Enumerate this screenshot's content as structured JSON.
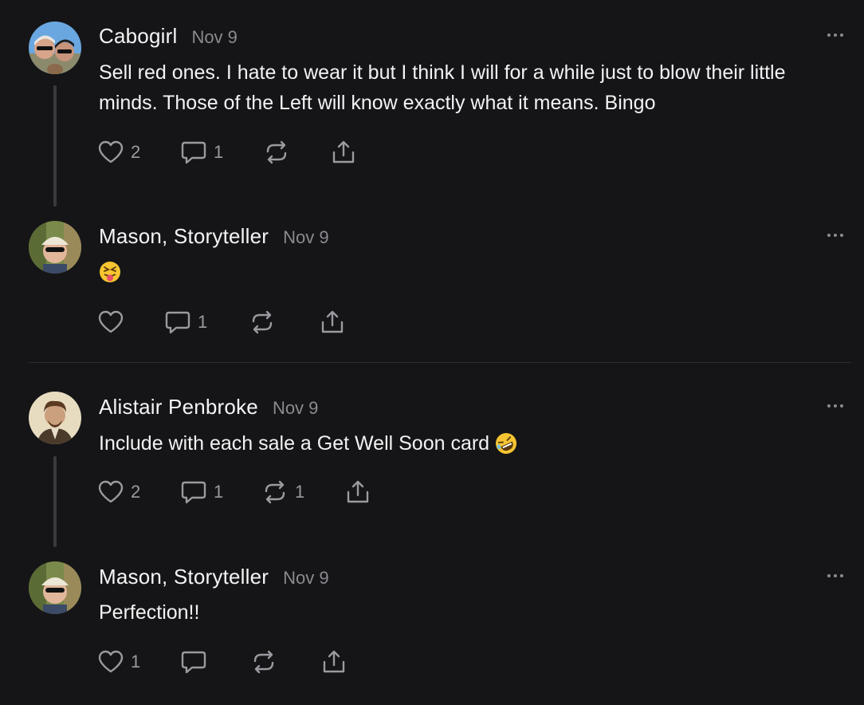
{
  "comments": [
    {
      "author": "Cabogirl",
      "date": "Nov 9",
      "text": "Sell red ones. I hate to wear it but I think I will for a while just to blow their little minds. Those of the Left will know exactly what it means. Bingo",
      "likes": "2",
      "replies": "1",
      "restacks": "",
      "avatar": "avatar-couple"
    },
    {
      "author": "Mason, Storyteller",
      "date": "Nov 9",
      "text": "😝",
      "likes": "",
      "replies": "1",
      "restacks": "",
      "avatar": "avatar-man-cap"
    },
    {
      "author": "Alistair Penbroke",
      "date": "Nov 9",
      "text": "Include with each sale a Get Well Soon card",
      "emoji": "🤣",
      "likes": "2",
      "replies": "1",
      "restacks": "1",
      "avatar": "avatar-painted-man"
    },
    {
      "author": "Mason, Storyteller",
      "date": "Nov 9",
      "text": "Perfection!!",
      "likes": "1",
      "replies": "",
      "restacks": "",
      "avatar": "avatar-man-cap"
    }
  ],
  "icons": {
    "like": "heart-icon",
    "reply": "comment-bubble-icon",
    "restack": "restack-icon",
    "share": "share-icon",
    "more": "more-options-icon"
  },
  "colors": {
    "background": "#151517",
    "text": "#f2f2f3",
    "muted": "#8a8a90",
    "thread_line": "#3a3a3e"
  }
}
